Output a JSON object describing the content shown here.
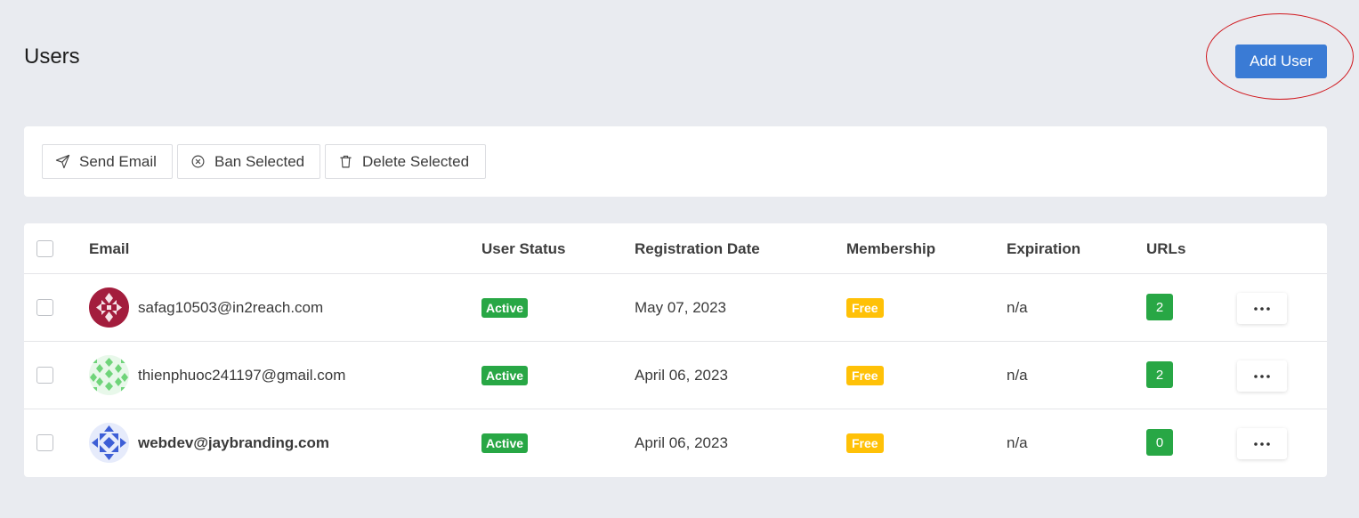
{
  "header": {
    "title": "Users",
    "add_user_label": "Add User"
  },
  "bulk_actions": {
    "send_email": "Send Email",
    "ban_selected": "Ban Selected",
    "delete_selected": "Delete Selected"
  },
  "table": {
    "columns": [
      "Email",
      "User Status",
      "Registration Date",
      "Membership",
      "Expiration",
      "URLs"
    ],
    "rows": [
      {
        "email": "safag10503@in2reach.com",
        "status": "Active",
        "registration_date": "May 07, 2023",
        "membership": "Free",
        "expiration": "n/a",
        "urls": "2",
        "avatar_color": "#a31d3d"
      },
      {
        "email": "thienphuoc241197@gmail.com",
        "status": "Active",
        "registration_date": "April 06, 2023",
        "membership": "Free",
        "expiration": "n/a",
        "urls": "2",
        "avatar_color": "#6fd47a"
      },
      {
        "email": "webdev@jaybranding.com",
        "status": "Active",
        "registration_date": "April 06, 2023",
        "membership": "Free",
        "expiration": "n/a",
        "urls": "0",
        "avatar_color": "#3d5ed6"
      }
    ]
  },
  "colors": {
    "primary": "#3a7bd5",
    "success": "#28a745",
    "warning": "#ffc107",
    "highlight": "#d0161c",
    "background": "#e9ebf0"
  }
}
